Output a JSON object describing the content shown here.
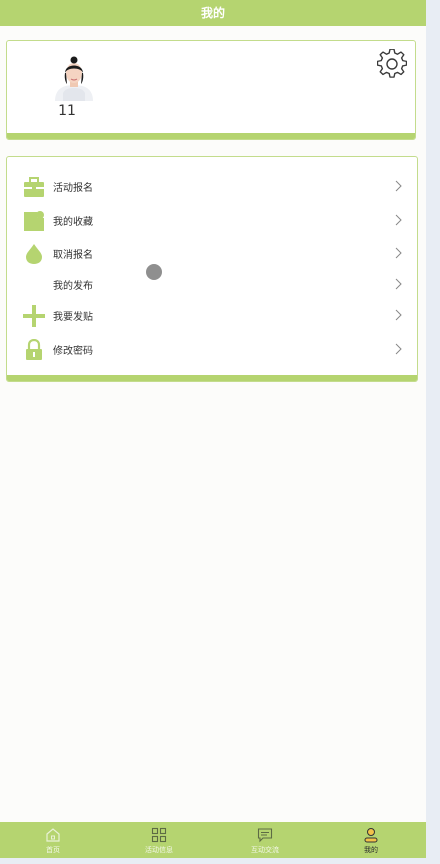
{
  "header": {
    "title": "我的"
  },
  "profile": {
    "username": "11",
    "settings_icon": "gear-icon"
  },
  "menu": {
    "items": [
      {
        "label": "活动报名",
        "icon": "briefcase-icon"
      },
      {
        "label": "我的收藏",
        "icon": "bookmark-icon"
      },
      {
        "label": "取消报名",
        "icon": "drop-icon"
      },
      {
        "label": "我的发布",
        "icon": ""
      },
      {
        "label": "我要发贴",
        "icon": "plus-icon"
      },
      {
        "label": "修改密码",
        "icon": "lock-icon"
      }
    ]
  },
  "tabbar": {
    "tabs": [
      {
        "label": "首页",
        "icon": "home-icon",
        "active": false
      },
      {
        "label": "活动信息",
        "icon": "grid-icon",
        "active": false
      },
      {
        "label": "互动交流",
        "icon": "message-icon",
        "active": false
      },
      {
        "label": "我的",
        "icon": "person-icon",
        "active": true
      }
    ]
  },
  "colors": {
    "accent": "#b5d470",
    "card_border": "#c3dc8c",
    "text": "#333333"
  }
}
